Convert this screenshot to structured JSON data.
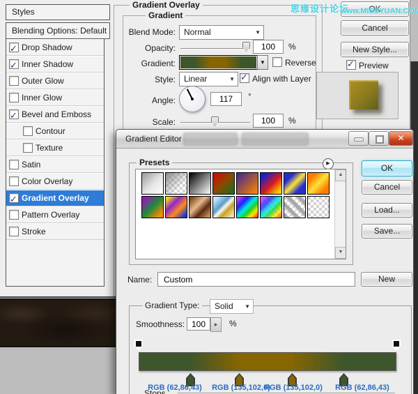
{
  "watermark": {
    "text_cn": "思缘设计论坛",
    "text_en": "www.MISSYUAN.COM",
    "color": "#4bd0e4"
  },
  "colors": {
    "selection_blue": "#2e7cd8",
    "dialog_bg": "#eeeeee",
    "rgb_label_blue": "#2a6cc4",
    "gradient_green": "#3e562b",
    "gradient_gold": "#876600"
  },
  "layer_style": {
    "styles_header": "Styles",
    "blending_options": "Blending Options: Default",
    "style_items": [
      {
        "label": "Drop Shadow",
        "checked": true,
        "indent": false,
        "selected": false
      },
      {
        "label": "Inner Shadow",
        "checked": true,
        "indent": false,
        "selected": false
      },
      {
        "label": "Outer Glow",
        "checked": false,
        "indent": false,
        "selected": false
      },
      {
        "label": "Inner Glow",
        "checked": false,
        "indent": false,
        "selected": false
      },
      {
        "label": "Bevel and Emboss",
        "checked": true,
        "indent": false,
        "selected": false
      },
      {
        "label": "Contour",
        "checked": false,
        "indent": true,
        "selected": false
      },
      {
        "label": "Texture",
        "checked": false,
        "indent": true,
        "selected": false
      },
      {
        "label": "Satin",
        "checked": false,
        "indent": false,
        "selected": false
      },
      {
        "label": "Color Overlay",
        "checked": false,
        "indent": false,
        "selected": false
      },
      {
        "label": "Gradient Overlay",
        "checked": true,
        "indent": false,
        "selected": true
      },
      {
        "label": "Pattern Overlay",
        "checked": false,
        "indent": false,
        "selected": false
      },
      {
        "label": "Stroke",
        "checked": false,
        "indent": false,
        "selected": false
      }
    ],
    "panel_title": "Gradient Overlay",
    "group_title": "Gradient",
    "blend_mode": {
      "label": "Blend Mode:",
      "value": "Normal"
    },
    "opacity": {
      "label": "Opacity:",
      "value": "100",
      "unit": "%"
    },
    "gradient": {
      "label": "Gradient:",
      "reverse_label": "Reverse",
      "reverse_checked": false
    },
    "style_row": {
      "label": "Style:",
      "value": "Linear",
      "align_label": "Align with Layer",
      "align_checked": true
    },
    "angle": {
      "label": "Angle:",
      "value": "117",
      "unit": "°"
    },
    "scale": {
      "label": "Scale:",
      "value": "100",
      "unit": "%"
    },
    "buttons": {
      "ok": "OK",
      "cancel": "Cancel",
      "new_style": "New Style...",
      "preview_label": "Preview",
      "preview_checked": true
    },
    "preview_thumb_bg": "linear-gradient(135deg,#ab8d20 0%,#8a7a1e 55%,#615f1e 100%)"
  },
  "gradient_editor": {
    "title": "Gradient Editor",
    "presets_label": "Presets",
    "buttons": {
      "ok": "OK",
      "cancel": "Cancel",
      "load": "Load...",
      "save": "Save..."
    },
    "name_row": {
      "label": "Name:",
      "value": "Custom",
      "new_button": "New"
    },
    "gradient_type": {
      "label": "Gradient Type:",
      "value": "Solid"
    },
    "smoothness": {
      "label": "Smoothness:",
      "value": "100",
      "unit": "%"
    },
    "stops_section_label": "Stops",
    "gradient_bar": {
      "css": "linear-gradient(to right,#3e562b 0%,#3e562b 20%,#876600 39%,#876600 59%,#3e562b 80%,#3e562b 100%)",
      "opacity_stops_pct": [
        0,
        100
      ],
      "stops": [
        {
          "position_pct": 20,
          "color": "#3e562b",
          "label": "RGB (62,86,43)"
        },
        {
          "position_pct": 39,
          "color": "#876600",
          "label": "RGB (135,102,0)"
        },
        {
          "position_pct": 59,
          "color": "#876600",
          "label": "RGB (135,102,0)"
        },
        {
          "position_pct": 80,
          "color": "#3e562b",
          "label": "RGB (62,86,43)"
        }
      ]
    },
    "presets": [
      {
        "name": "foreground-to-background",
        "bg": "linear-gradient(135deg,#9a9a9a,#e6e6e6 55%,#ffffff)"
      },
      {
        "name": "foreground-to-transparent",
        "bg": "linear-gradient(135deg,#8c8c8c,rgba(140,140,140,0) 70%), conic-gradient(#ffffff 25%,#d2d2d2 25% 50%,#ffffff 50% 75%,#d2d2d2 75%) 0 0/8px 8px"
      },
      {
        "name": "black-to-white",
        "bg": "linear-gradient(135deg,#000000,#ffffff)"
      },
      {
        "name": "red-to-green",
        "bg": "linear-gradient(135deg,#dd0000,#8a4a00 50%,#11701c)"
      },
      {
        "name": "violet-to-orange",
        "bg": "linear-gradient(135deg,#42219a,#a85a3c 55%,#ff8a00)"
      },
      {
        "name": "blue-red-yellow",
        "bg": "linear-gradient(135deg,#1a21c8 15%,#d91b1b 55%,#ffd000 90%)"
      },
      {
        "name": "blue-yellow-blue",
        "bg": "linear-gradient(135deg,#2730cc 25%,#ffe13a 50%,#2730cc 75%)"
      },
      {
        "name": "orange-yellow-orange",
        "bg": "linear-gradient(135deg,#ff7c00 20%,#ffe13a 50%,#ff7c00 80%)"
      },
      {
        "name": "violet-green-orange",
        "bg": "linear-gradient(135deg,#8c1eb4 12%,#1e8a3c 50%,#ff8a00 88%)"
      },
      {
        "name": "yellow-violet-orange-blue",
        "bg": "linear-gradient(135deg,#ffd51e 8%,#8c28c8 35%,#ff8a1e 62%,#2038c8 92%)"
      },
      {
        "name": "copper",
        "bg": "linear-gradient(135deg,#7c4a1e 8%,#e8b88c 40%,#5a2c10 65%,#c8885a 92%)"
      },
      {
        "name": "chrome",
        "bg": "linear-gradient(135deg,#bfe8fa 12%,#5a9cc8 40%,#f8f8f0 52%,#c8a028 66%,#f0e0a0 90%)"
      },
      {
        "name": "spectrum",
        "bg": "linear-gradient(135deg,#ff3cff,#2020ff 28%,#00e8e8 48%,#20d020 64%,#ffe800 80%,#ff2020)"
      },
      {
        "name": "transparent-rainbow",
        "bg": "linear-gradient(135deg,rgba(255,60,255,.8),rgba(32,32,255,.8) 28%,rgba(0,232,232,.8) 48%,rgba(32,208,32,.8) 64%,rgba(255,232,0,.8) 80%,rgba(255,32,32,.8)), conic-gradient(#ffffff 25%,#d2d2d2 25% 50%,#ffffff 50% 75%,#d2d2d2 75%) 0 0/8px 8px"
      },
      {
        "name": "transparent-stripes",
        "bg": "repeating-linear-gradient(45deg,#a8a8a8 0 5px,rgba(255,255,255,0) 5px 11px), conic-gradient(#ffffff 25%,#d2d2d2 25% 50%,#ffffff 50% 75%,#d2d2d2 75%) 0 0/8px 8px"
      },
      {
        "name": "transparent",
        "bg": "conic-gradient(#ffffff 25%,#d2d2d2 25% 50%,#ffffff 50% 75%,#d2d2d2 75%) 0 0/8px 8px"
      }
    ]
  }
}
